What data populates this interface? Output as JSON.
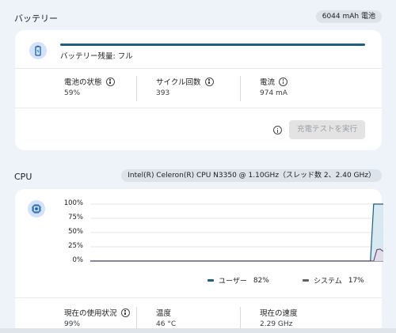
{
  "battery": {
    "title": "バッテリー",
    "capacity_chip": "6044 mAh 電池",
    "level_fraction": 1.0,
    "status_text": "バッテリー残量: フル",
    "stats": [
      {
        "label": "電池の状態",
        "value": "59%"
      },
      {
        "label": "サイクル回数",
        "value": "393"
      },
      {
        "label": "電流",
        "value": "974 mA"
      }
    ],
    "charge_test_button": "充電テストを実行"
  },
  "cpu": {
    "title": "CPU",
    "model_chip": "Intel(R) Celeron(R) CPU N3350 @ 1.10GHz（スレッド数 2、2.40 GHz）",
    "legend": [
      {
        "name": "ユーザー",
        "value": "82%",
        "color": "#1f5f86"
      },
      {
        "name": "システム",
        "value": "17%",
        "color": "#5f6368"
      }
    ],
    "stats": [
      {
        "label": "現在の使用状況",
        "value": "99%"
      },
      {
        "label": "温度",
        "value": "46 °C"
      },
      {
        "label": "現在の速度",
        "value": "2.29 GHz"
      }
    ]
  },
  "chart_data": {
    "type": "area",
    "ytick_labels": [
      "100%",
      "75%",
      "50%",
      "25%",
      "0%"
    ],
    "ylim": [
      0,
      100
    ],
    "grid": true,
    "series": [
      {
        "name": "ユーザー",
        "color": "#1f5f86",
        "fill": "#d5e7f0",
        "values": [
          0,
          0,
          0,
          0,
          0,
          0,
          0,
          0,
          0,
          0,
          0,
          0,
          0,
          0,
          0,
          0,
          0,
          0,
          0,
          0,
          0,
          0,
          0,
          0,
          0,
          0,
          0,
          0,
          0,
          0,
          0,
          0,
          0,
          0,
          0,
          0,
          0,
          0,
          0,
          0,
          0,
          0,
          0,
          0,
          0,
          0,
          0,
          0,
          0,
          0,
          0,
          0,
          0,
          0,
          0,
          0,
          0,
          0,
          0,
          0,
          0,
          0,
          0,
          0,
          0,
          0,
          0,
          0,
          0,
          0,
          0,
          0,
          0,
          0,
          0,
          0,
          0,
          0,
          0,
          0,
          0,
          0,
          0,
          0,
          0,
          0,
          0,
          0,
          100,
          100,
          100,
          100
        ]
      },
      {
        "name": "システム",
        "color": "#6a4f7a",
        "fill": "#e4dcea",
        "values": [
          0,
          0,
          0,
          0,
          0,
          0,
          0,
          0,
          0,
          0,
          0,
          0,
          0,
          0,
          0,
          0,
          0,
          0,
          0,
          0,
          0,
          0,
          0,
          0,
          0,
          0,
          0,
          0,
          0,
          0,
          0,
          0,
          0,
          0,
          0,
          0,
          0,
          0,
          0,
          0,
          0,
          0,
          0,
          0,
          0,
          0,
          0,
          0,
          0,
          0,
          0,
          0,
          0,
          0,
          0,
          0,
          0,
          0,
          0,
          0,
          0,
          0,
          0,
          0,
          0,
          0,
          0,
          0,
          0,
          0,
          0,
          0,
          0,
          0,
          0,
          0,
          0,
          0,
          0,
          0,
          0,
          0,
          0,
          0,
          0,
          0,
          0,
          0,
          0,
          20,
          21,
          17
        ]
      }
    ]
  },
  "icons": {
    "battery": "battery-icon",
    "cpu": "chip-icon",
    "info": "info-icon"
  }
}
